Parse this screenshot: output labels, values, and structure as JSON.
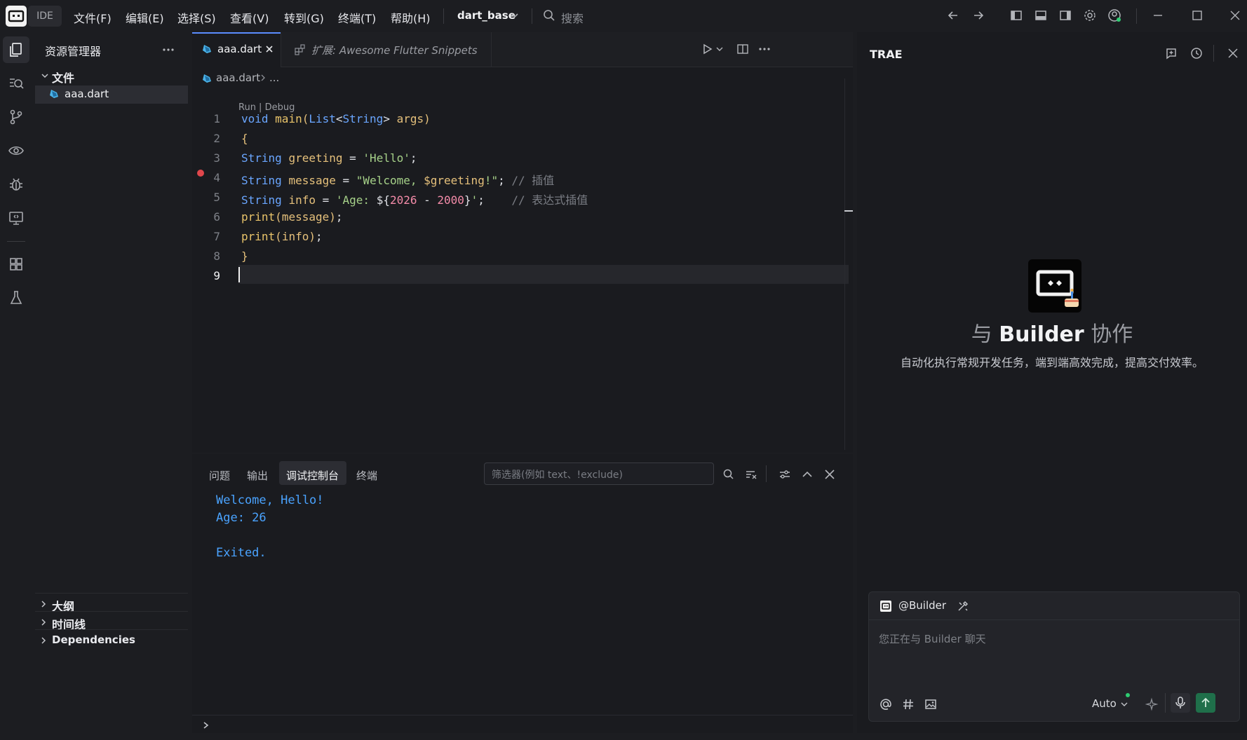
{
  "titlebar": {
    "ide_label": "IDE",
    "menus": [
      "文件(F)",
      "编辑(E)",
      "选择(S)",
      "查看(V)",
      "转到(G)",
      "终端(T)",
      "帮助(H)"
    ],
    "project": "dart_base",
    "search_placeholder": "搜索"
  },
  "explorer": {
    "title": "资源管理器",
    "folder": "文件",
    "file": "aaa.dart",
    "sections": [
      "大纲",
      "时间线",
      "Dependencies"
    ]
  },
  "editor": {
    "tabs": [
      {
        "label": "aaa.dart",
        "active": true
      },
      {
        "label": "扩展: Awesome Flutter Snippets",
        "active": false
      }
    ],
    "breadcrumb": [
      "aaa.dart",
      "..."
    ],
    "codelens": "Run | Debug",
    "line_numbers": [
      "1",
      "2",
      "3",
      "4",
      "5",
      "6",
      "7",
      "8",
      "9"
    ],
    "breakpoint_line": 2,
    "current_line": 9,
    "lines": [
      "void main(List<String> args)",
      "{",
      "String greeting = 'Hello';",
      "String message = \"Welcome, $greeting!\"; // 插值",
      "String info = 'Age: ${2026 - 2000}';    // 表达式插值",
      "print(message);",
      "print(info);",
      "}",
      ""
    ]
  },
  "panel": {
    "tabs": [
      "问题",
      "输出",
      "调试控制台",
      "终端"
    ],
    "active_tab": "调试控制台",
    "filter_placeholder": "筛选器(例如 text、!exclude)",
    "output": [
      "Welcome, Hello!",
      "Age: 26",
      "",
      "Exited."
    ]
  },
  "ai": {
    "title": "TRAE",
    "heading_prefix": "与",
    "heading_name": "Builder",
    "heading_suffix": "协作",
    "subtitle": "自动化执行常规开发任务，端到端高效完成，提高交付效率。",
    "agent": "@Builder",
    "input_placeholder": "您正在与 Builder 聊天",
    "model": "Auto"
  },
  "colors": {
    "accent": "#5b8cff",
    "breakpoint": "#e0474c",
    "output": "#4aa3ff",
    "send": "#1f6f4a"
  }
}
